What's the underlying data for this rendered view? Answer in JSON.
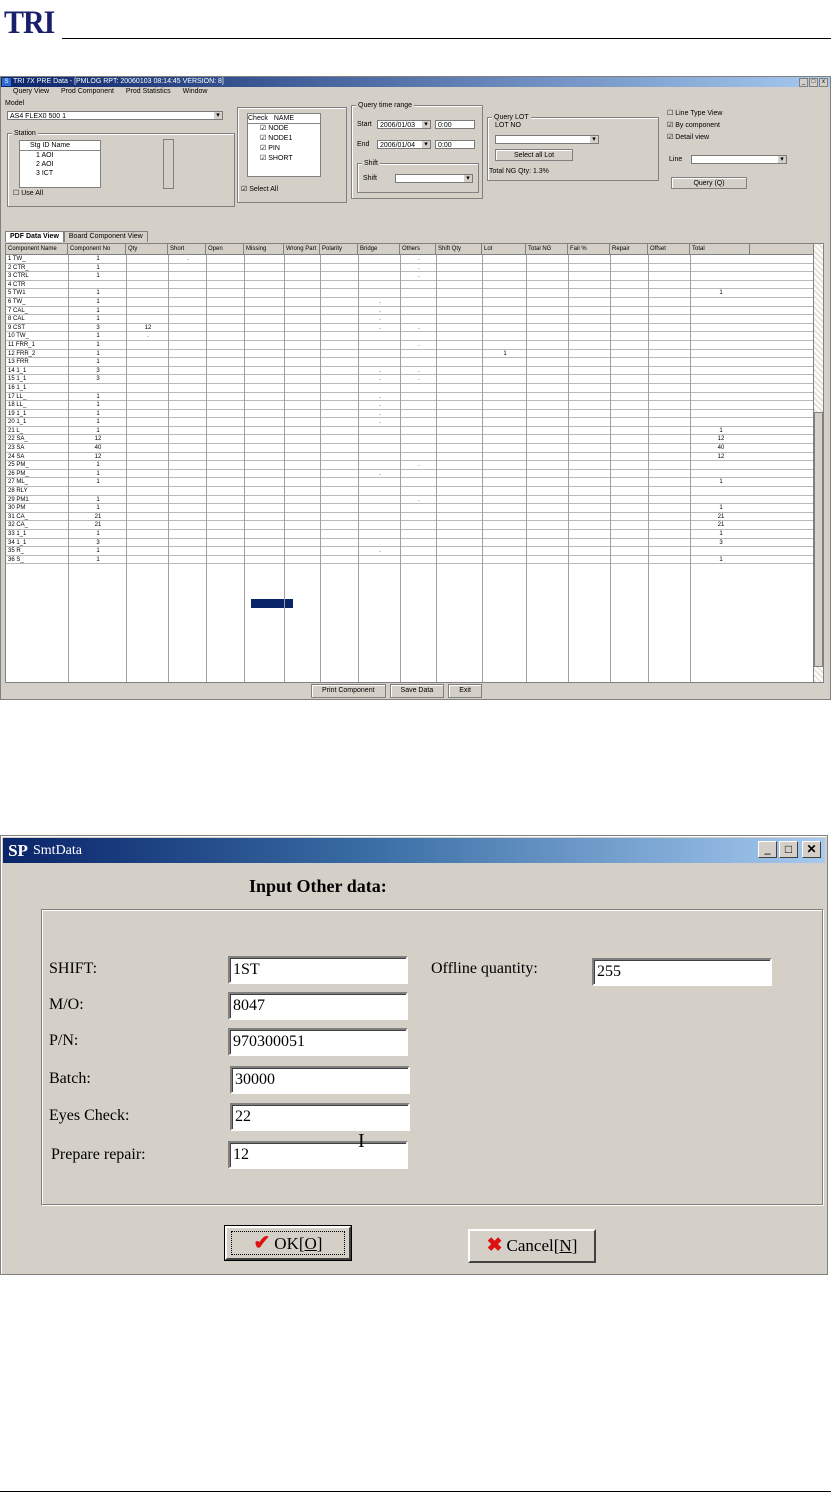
{
  "doc": {
    "logo": "TRI"
  },
  "main_window": {
    "title": "TRI 7X PRE Data - [PMLOG RPT: 20060103 08:14:45 VERSION: 8]",
    "menu": [
      "Query View",
      "Prod Component",
      "Prod Statistics",
      "Window"
    ],
    "model": {
      "label": "Model",
      "value": "AS4 FLEX0 500 1"
    },
    "station": {
      "label": "Station",
      "header": "Stg ID Name",
      "rows": [
        "1 AOI",
        "2 AOI",
        "3 ICT"
      ]
    },
    "use_all": "Use All",
    "col_box": {
      "header_a": "Check",
      "header_b": "NAME",
      "rows": [
        "NODE",
        "NODE1",
        "PIN",
        "SHORT"
      ],
      "select_all": "Select All"
    },
    "time_group": {
      "label": "Query time range",
      "start_label": "Start",
      "start_date": "2006/01/03",
      "start_time": "0:00",
      "end_label": "End",
      "end_date": "2006/01/04",
      "end_time": "0:00",
      "shift_label": "Shift",
      "shift_sub": "Shift"
    },
    "lot_group": {
      "label": "Query LOT",
      "lot_no": "LOT NO",
      "btn": "Select all Lot",
      "note": "Total NG Qty: 1.3%"
    },
    "options": [
      "Line Type View",
      "By component",
      "Detail view"
    ],
    "line_label": "Line",
    "query_btn": "Query (Q)",
    "tabs": [
      "PDF Data View",
      "Board Component View"
    ],
    "grid": {
      "headers": [
        "Component Name",
        "Component No",
        "Qty",
        "Short",
        "Open",
        "Missing",
        "Wrong Part",
        "Polarity",
        "Bridge",
        "Others",
        "Shift Qty",
        "Lot",
        "Total NG",
        "Fail %",
        "Repair",
        "Offset",
        "Total"
      ],
      "rows": [
        [
          "1 TW_",
          "1",
          "",
          ".",
          "",
          "",
          "",
          "",
          "",
          ".",
          "",
          "",
          "",
          "",
          "",
          "",
          ""
        ],
        [
          "2 CTR_",
          "1",
          "",
          "",
          "",
          "",
          "",
          "",
          "",
          ".",
          "",
          "",
          "",
          "",
          "",
          "",
          ""
        ],
        [
          "3 CTRL",
          "1",
          "",
          "",
          "",
          "",
          "",
          "",
          "",
          ".",
          "",
          "",
          "",
          "",
          "",
          "",
          ""
        ],
        [
          "4 CTR",
          "",
          "",
          "",
          "",
          "",
          "",
          "",
          "",
          "",
          "",
          "",
          "",
          "",
          "",
          "",
          ""
        ],
        [
          "5 TW1",
          "1",
          "",
          "",
          "",
          "",
          "",
          "",
          "",
          "",
          "",
          "",
          "",
          "",
          "",
          "",
          "1"
        ],
        [
          "6 TW_",
          "1",
          "",
          "",
          "",
          "",
          "",
          "",
          ".",
          "",
          "",
          "",
          "",
          "",
          "",
          "",
          ""
        ],
        [
          "7 CAL_",
          "1",
          "",
          "",
          "",
          "",
          "",
          "",
          ".",
          "",
          "",
          "",
          "",
          "",
          "",
          "",
          ""
        ],
        [
          "8 CAL",
          "1",
          "",
          "",
          "",
          "",
          "",
          "",
          ".",
          "",
          "",
          "",
          "",
          "",
          "",
          "",
          ""
        ],
        [
          "9 CST",
          "3",
          "12",
          "",
          "",
          "",
          "",
          "",
          ".",
          ".",
          "",
          "",
          "",
          "",
          "",
          "",
          ""
        ],
        [
          "10 TW_",
          "1",
          ".",
          "",
          "",
          "",
          "",
          "",
          "",
          "",
          "",
          "",
          "",
          "",
          "",
          "",
          ""
        ],
        [
          "11 FRR_1",
          "1",
          "",
          "",
          "",
          "",
          "",
          "",
          "",
          ".",
          "",
          "",
          "",
          "",
          "",
          "",
          ""
        ],
        [
          "12 FRR_2",
          "1",
          "",
          "",
          "",
          "",
          "",
          "",
          "",
          "",
          "",
          "1",
          "",
          "",
          "",
          "",
          ""
        ],
        [
          "13 FRR",
          "1",
          "",
          "",
          "",
          "",
          "",
          "",
          "",
          "",
          "",
          "",
          "",
          "",
          "",
          "",
          ""
        ],
        [
          "14 1_1",
          "3",
          "",
          "",
          "",
          "",
          "",
          "",
          ".",
          ".",
          "",
          "",
          "",
          "",
          "",
          "",
          ""
        ],
        [
          "15 1_1",
          "3",
          "",
          "",
          "",
          "",
          "",
          "",
          ".",
          ".",
          "",
          "",
          "",
          "",
          "",
          "",
          ""
        ],
        [
          "16 1_1",
          "",
          "",
          "",
          "",
          "",
          "",
          "",
          "",
          "",
          "",
          "",
          "",
          "",
          "",
          "",
          ""
        ],
        [
          "17 LL_",
          "1",
          "",
          "",
          "",
          "",
          "",
          "",
          ".",
          "",
          "",
          "",
          "",
          "",
          "",
          "",
          ""
        ],
        [
          "18 LL_",
          "1",
          "",
          "",
          "",
          "",
          "",
          "",
          ".",
          "",
          "",
          "",
          "",
          "",
          "",
          "",
          ""
        ],
        [
          "19 1_1",
          "1",
          "",
          "",
          "",
          "",
          "",
          "",
          ".",
          "",
          "",
          "",
          "",
          "",
          "",
          "",
          ""
        ],
        [
          "20 1_1",
          "1",
          "",
          "",
          "",
          "",
          "",
          "",
          ".",
          "",
          "",
          "",
          "",
          "",
          "",
          "",
          ""
        ],
        [
          "21 L_",
          "1",
          "",
          "",
          "",
          "",
          "",
          "",
          "",
          "",
          "",
          "",
          "",
          "",
          "",
          "",
          "1"
        ],
        [
          "22 SA_",
          "12",
          "",
          "",
          "",
          "",
          "",
          "",
          "",
          "",
          "",
          "",
          "",
          "",
          "",
          "",
          "12"
        ],
        [
          "23 SA",
          "40",
          "",
          "",
          "",
          "",
          "",
          "",
          "",
          "",
          "",
          "",
          "",
          "",
          "",
          "",
          "40"
        ],
        [
          "24 SA",
          "12",
          "",
          "",
          "",
          "",
          "",
          "",
          "",
          "",
          "",
          "",
          "",
          "",
          "",
          "",
          "12"
        ],
        [
          "25 PM_",
          "1",
          "",
          "",
          "",
          "",
          "",
          "",
          "",
          ".",
          "",
          "",
          "",
          "",
          "",
          "",
          ""
        ],
        [
          "26 PM_",
          "1",
          "",
          "",
          "",
          "",
          "",
          "",
          ".",
          "",
          "",
          "",
          "",
          "",
          "",
          "",
          ""
        ],
        [
          "27 ML_",
          "1",
          "",
          "",
          "",
          "",
          "",
          "",
          "",
          "",
          "",
          "",
          "",
          "",
          "",
          "",
          "1"
        ],
        [
          "28 RLY",
          "",
          "",
          "",
          "",
          "",
          "",
          "",
          "",
          "",
          "",
          "",
          "",
          "",
          "",
          "",
          ""
        ],
        [
          "29 PM1",
          "1",
          "",
          "",
          "",
          "",
          "",
          "",
          "",
          ".",
          "",
          "",
          "",
          "",
          "",
          "",
          ""
        ],
        [
          "30 PM",
          "1",
          "",
          "",
          "",
          "",
          "",
          "",
          "",
          "",
          "",
          "",
          "",
          "",
          "",
          "",
          "1"
        ],
        [
          "31 CA_",
          "21",
          "",
          "",
          "",
          "",
          "",
          "",
          "",
          "",
          "",
          "",
          "",
          "",
          "",
          "",
          "21"
        ],
        [
          "32 CA_",
          "21",
          "",
          "",
          "",
          "",
          "",
          "",
          "",
          "",
          "",
          "",
          "",
          "",
          "",
          "",
          "21"
        ],
        [
          "33 1_1",
          "1",
          "",
          "",
          "",
          "",
          "",
          "",
          "",
          "",
          "",
          "",
          "",
          "",
          "",
          "",
          "1"
        ],
        [
          "34 1_1",
          "3",
          "",
          "",
          "",
          "",
          "",
          "",
          "",
          "",
          "",
          "",
          "",
          "",
          "",
          "",
          "3"
        ],
        [
          "35 R_",
          "1",
          "",
          "",
          "",
          "",
          "",
          "",
          ".",
          "",
          "",
          "",
          "",
          "",
          "",
          "",
          ""
        ],
        [
          "36 S_",
          "1",
          "",
          "",
          "",
          "",
          "",
          "",
          "",
          "",
          "",
          "",
          "",
          "",
          "",
          "",
          "1"
        ]
      ]
    },
    "bottom_buttons": [
      "Print Component",
      "Save Data",
      "Exit"
    ]
  },
  "dialog": {
    "title": "SmtData",
    "icon": "spc-app-icon",
    "heading": "Input Other data:",
    "fields": {
      "shift": {
        "label": "SHIFT:",
        "value": "1ST"
      },
      "mo": {
        "label": "M/O:",
        "value": "8047"
      },
      "pn": {
        "label": "P/N:",
        "value": "970300051"
      },
      "batch": {
        "label": "Batch:",
        "value": "30000"
      },
      "eyes": {
        "label": "Eyes Check:",
        "value": "22"
      },
      "prepare": {
        "label": "Prepare repair:",
        "value": "12"
      },
      "offline": {
        "label": "Offline quantity:",
        "value": "255"
      }
    },
    "ok": {
      "text": "OK[",
      "key": "O",
      "end": "]"
    },
    "cancel": {
      "text": "Cancel[",
      "key": "N",
      "end": "]"
    }
  }
}
